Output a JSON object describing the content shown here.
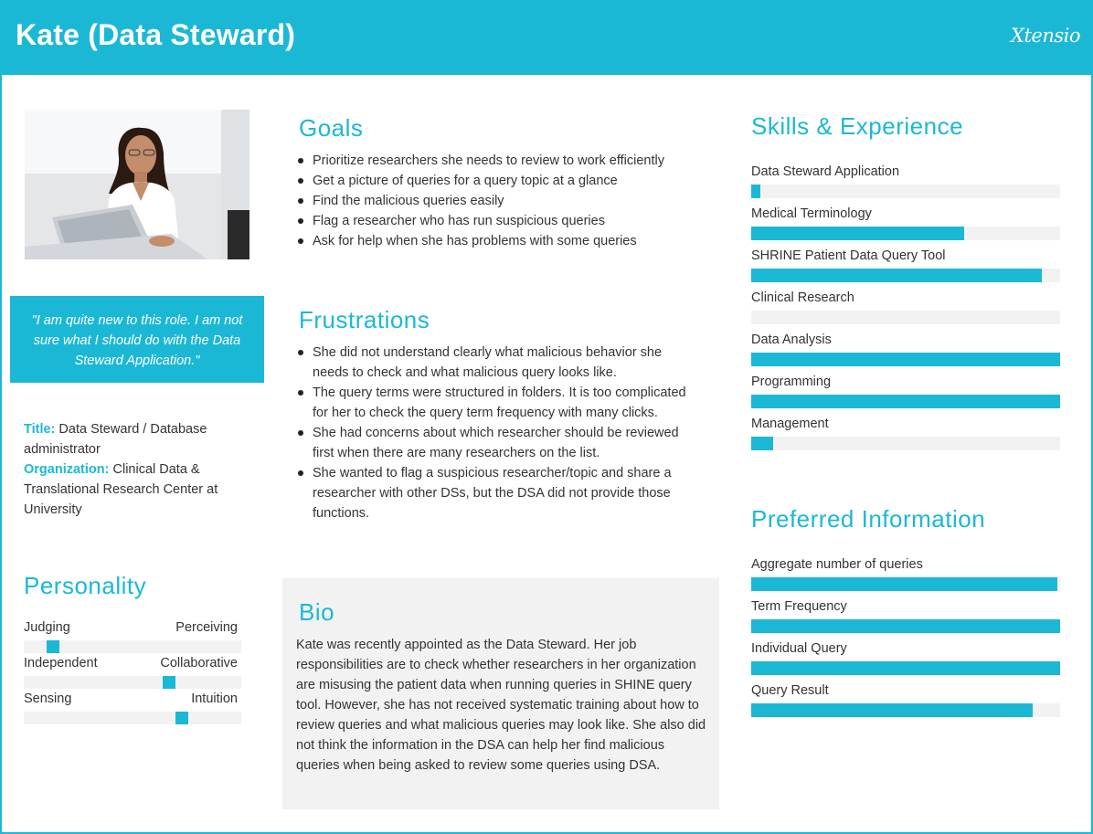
{
  "header": {
    "name": "Kate (Data Steward)",
    "logo": "Xtensio"
  },
  "quote": "\"I am quite new to this role. I am not sure what I should do with the Data Steward Application.\"",
  "profile": {
    "title_label": "Title",
    "title_value": "Data Steward / Database administrator",
    "org_label": "Organization",
    "org_value": "Clinical Data & Translational Research Center at University"
  },
  "personality": {
    "title": "Personality",
    "traits": [
      {
        "left": "Judging",
        "right": "Perceiving",
        "value": 0.11
      },
      {
        "left": "Independent",
        "right": "Collaborative",
        "value": 0.68
      },
      {
        "left": "Sensing",
        "right": "Intuition",
        "value": 0.74
      }
    ]
  },
  "goals": {
    "title": "Goals",
    "items": [
      "Prioritize researchers she needs to review to work efficiently",
      "Get a picture of queries for a query topic at a glance",
      "Find the malicious queries easily",
      "Flag a researcher who has run suspicious queries",
      "Ask for help when she has problems with some queries"
    ]
  },
  "frustrations": {
    "title": "Frustrations",
    "items": [
      "She did not understand clearly what malicious behavior she needs to check and what malicious query looks like.",
      "The query terms were structured in folders. It is too complicated for her to check the query term frequency with many clicks.",
      "She had concerns about which researcher should be reviewed first when there are many researchers on the list.",
      "She wanted to flag a suspicious researcher/topic and share a researcher with other DSs, but the DSA did not provide those functions."
    ]
  },
  "bio": {
    "title": "Bio",
    "text": "Kate was recently appointed as the Data Steward. Her job responsibilities are to check whether researchers in her organization are misusing the patient data when running queries in SHINE query tool. However, she has not received systematic training about how to review queries and what malicious queries may look like. She also did not think the information in the DSA can help her find malicious queries when being asked to review some queries using DSA."
  },
  "skills": {
    "title": "Skills & Experience",
    "items": [
      {
        "label": "Data Steward Application",
        "value": 0.03
      },
      {
        "label": "Medical Terminology",
        "value": 0.69
      },
      {
        "label": "SHRINE Patient Data Query Tool",
        "value": 0.94
      },
      {
        "label": "Clinical Research",
        "value": 0.0
      },
      {
        "label": "Data Analysis",
        "value": 1.0
      },
      {
        "label": "Programming",
        "value": 1.0
      },
      {
        "label": "Management",
        "value": 0.07
      }
    ]
  },
  "preferred": {
    "title": "Preferred Information",
    "items": [
      {
        "label": "Aggregate number of queries",
        "value": 0.99
      },
      {
        "label": "Term Frequency",
        "value": 1.0
      },
      {
        "label": "Individual Query",
        "value": 1.0
      },
      {
        "label": "Query Result",
        "value": 0.91
      }
    ]
  },
  "colors": {
    "accent": "#1bb8d6",
    "track": "#f2f2f2",
    "text": "#333333"
  }
}
